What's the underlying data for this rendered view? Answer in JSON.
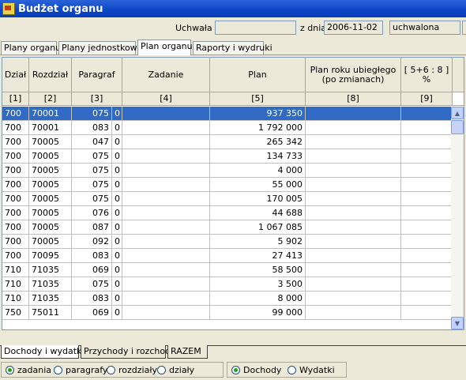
{
  "window": {
    "title": "Budżet organu"
  },
  "header": {
    "uchwala_label": "Uchwała",
    "uchwala_value": "",
    "zdnia_label": "z dnia",
    "date_value": "2006-11-02",
    "status_value": "uchwalona",
    "extra_value": ""
  },
  "tabs": [
    "Plany organu",
    "Plany jednostkowe",
    "Plan organu",
    "Raporty i wydruki"
  ],
  "grid": {
    "columns": [
      "Dział",
      "Rozdział",
      "Paragraf",
      "Zadanie",
      "Plan",
      "Plan roku ubiegłego\n(po zmianach)",
      "[ 5+6 : 8 ]\n%"
    ],
    "column_numbers": [
      "[1]",
      "[2]",
      "[3]",
      "[4]",
      "[5]",
      "[8]",
      "[9]"
    ],
    "rows": [
      {
        "dzial": "700",
        "rozdzial": "70001",
        "paragraf": "075",
        "p": "0",
        "zadanie": "",
        "plan": "937 350",
        "ub": "",
        "pct": ""
      },
      {
        "dzial": "700",
        "rozdzial": "70001",
        "paragraf": "083",
        "p": "0",
        "zadanie": "",
        "plan": "1 792 000",
        "ub": "",
        "pct": ""
      },
      {
        "dzial": "700",
        "rozdzial": "70005",
        "paragraf": "047",
        "p": "0",
        "zadanie": "",
        "plan": "265 342",
        "ub": "",
        "pct": ""
      },
      {
        "dzial": "700",
        "rozdzial": "70005",
        "paragraf": "075",
        "p": "0",
        "zadanie": "",
        "plan": "134 733",
        "ub": "",
        "pct": ""
      },
      {
        "dzial": "700",
        "rozdzial": "70005",
        "paragraf": "075",
        "p": "0",
        "zadanie": "",
        "plan": "4 000",
        "ub": "",
        "pct": ""
      },
      {
        "dzial": "700",
        "rozdzial": "70005",
        "paragraf": "075",
        "p": "0",
        "zadanie": "",
        "plan": "55 000",
        "ub": "",
        "pct": ""
      },
      {
        "dzial": "700",
        "rozdzial": "70005",
        "paragraf": "075",
        "p": "0",
        "zadanie": "",
        "plan": "170 005",
        "ub": "",
        "pct": ""
      },
      {
        "dzial": "700",
        "rozdzial": "70005",
        "paragraf": "076",
        "p": "0",
        "zadanie": "",
        "plan": "44 688",
        "ub": "",
        "pct": ""
      },
      {
        "dzial": "700",
        "rozdzial": "70005",
        "paragraf": "087",
        "p": "0",
        "zadanie": "",
        "plan": "1 067 085",
        "ub": "",
        "pct": ""
      },
      {
        "dzial": "700",
        "rozdzial": "70005",
        "paragraf": "092",
        "p": "0",
        "zadanie": "",
        "plan": "5 902",
        "ub": "",
        "pct": ""
      },
      {
        "dzial": "700",
        "rozdzial": "70095",
        "paragraf": "083",
        "p": "0",
        "zadanie": "",
        "plan": "27 413",
        "ub": "",
        "pct": ""
      },
      {
        "dzial": "710",
        "rozdzial": "71035",
        "paragraf": "069",
        "p": "0",
        "zadanie": "",
        "plan": "58 500",
        "ub": "",
        "pct": ""
      },
      {
        "dzial": "710",
        "rozdzial": "71035",
        "paragraf": "075",
        "p": "0",
        "zadanie": "",
        "plan": "3 500",
        "ub": "",
        "pct": ""
      },
      {
        "dzial": "710",
        "rozdzial": "71035",
        "paragraf": "083",
        "p": "0",
        "zadanie": "",
        "plan": "8 000",
        "ub": "",
        "pct": ""
      },
      {
        "dzial": "750",
        "rozdzial": "75011",
        "paragraf": "069",
        "p": "0",
        "zadanie": "",
        "plan": "99 000",
        "ub": "",
        "pct": ""
      }
    ],
    "selected_row": 0
  },
  "bottom_tabs": [
    "Dochody i wydatki",
    "Przychody i rozchody",
    "RAZEM"
  ],
  "radios_level": [
    "zadania",
    "paragrafy",
    "rozdziały",
    "działy"
  ],
  "radios_level_selected": 0,
  "radios_type": [
    "Dochody",
    "Wydatki"
  ],
  "radios_type_selected": 0,
  "colors": {
    "title_bar": "#0b45c6",
    "selection": "#316ac5",
    "window_bg": "#ece9d8"
  }
}
